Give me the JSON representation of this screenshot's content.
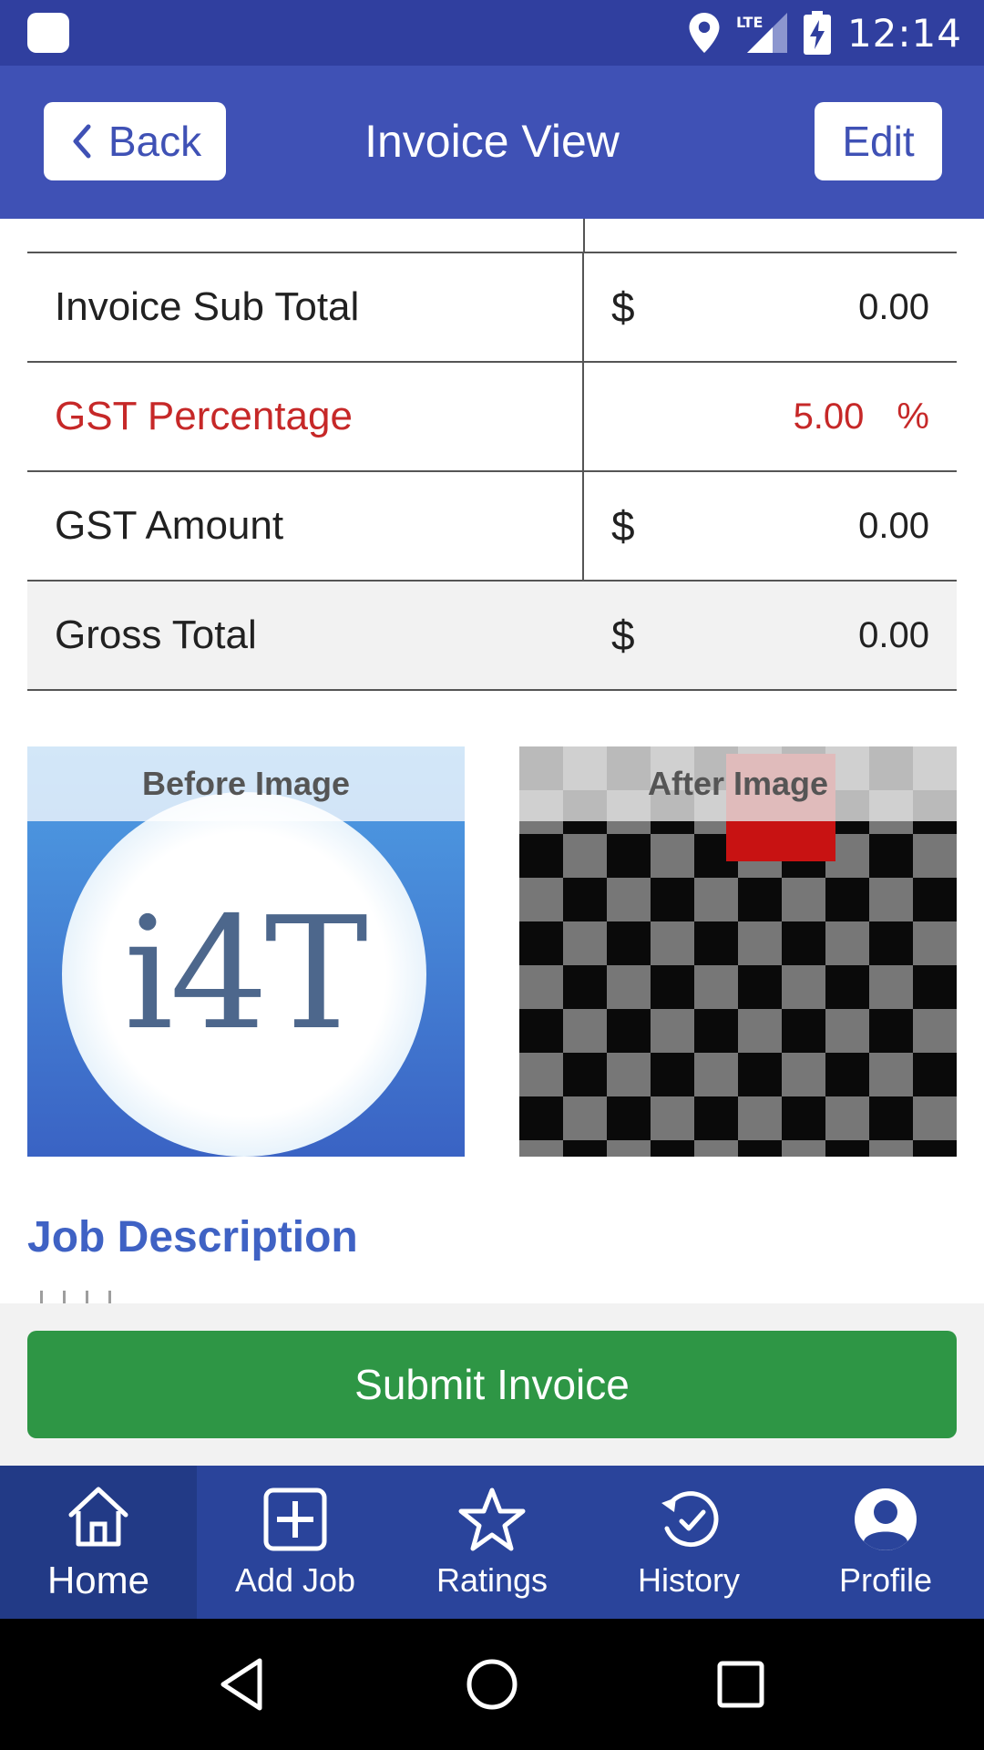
{
  "status_bar": {
    "time": "12:14",
    "network": "LTE",
    "icons": [
      "app-notification-icon",
      "location-pin-icon",
      "signal-icon",
      "battery-charging-icon"
    ]
  },
  "app_bar": {
    "back_label": "Back",
    "title": "Invoice View",
    "edit_label": "Edit"
  },
  "totals": [
    {
      "label": "Invoice Sub Total",
      "currency": "$",
      "value": "0.00",
      "suffix": ""
    },
    {
      "label": "GST Percentage",
      "currency": "",
      "value": "5.00",
      "suffix": "%"
    },
    {
      "label": "GST Amount",
      "currency": "$",
      "value": "0.00",
      "suffix": ""
    },
    {
      "label": "Gross Total",
      "currency": "$",
      "value": "0.00",
      "suffix": ""
    }
  ],
  "images": {
    "before_label": "Before Image",
    "after_label": "After Image",
    "before_logo_text": "i4T"
  },
  "job_description": {
    "heading": "Job Description"
  },
  "submit_label": "Submit Invoice",
  "bottom_nav": [
    {
      "label": "Home",
      "icon": "home-icon",
      "active": true
    },
    {
      "label": "Add Job",
      "icon": "add-box-icon",
      "active": false
    },
    {
      "label": "Ratings",
      "icon": "star-icon",
      "active": false
    },
    {
      "label": "History",
      "icon": "history-icon",
      "active": false
    },
    {
      "label": "Profile",
      "icon": "profile-icon",
      "active": false
    }
  ],
  "colors": {
    "primary": "#3f51b5",
    "status_bar": "#303f9f",
    "accent_red": "#c62828",
    "submit_green": "#2e9645",
    "nav_bg": "#2a449b",
    "heading_blue": "#3f62c4"
  }
}
